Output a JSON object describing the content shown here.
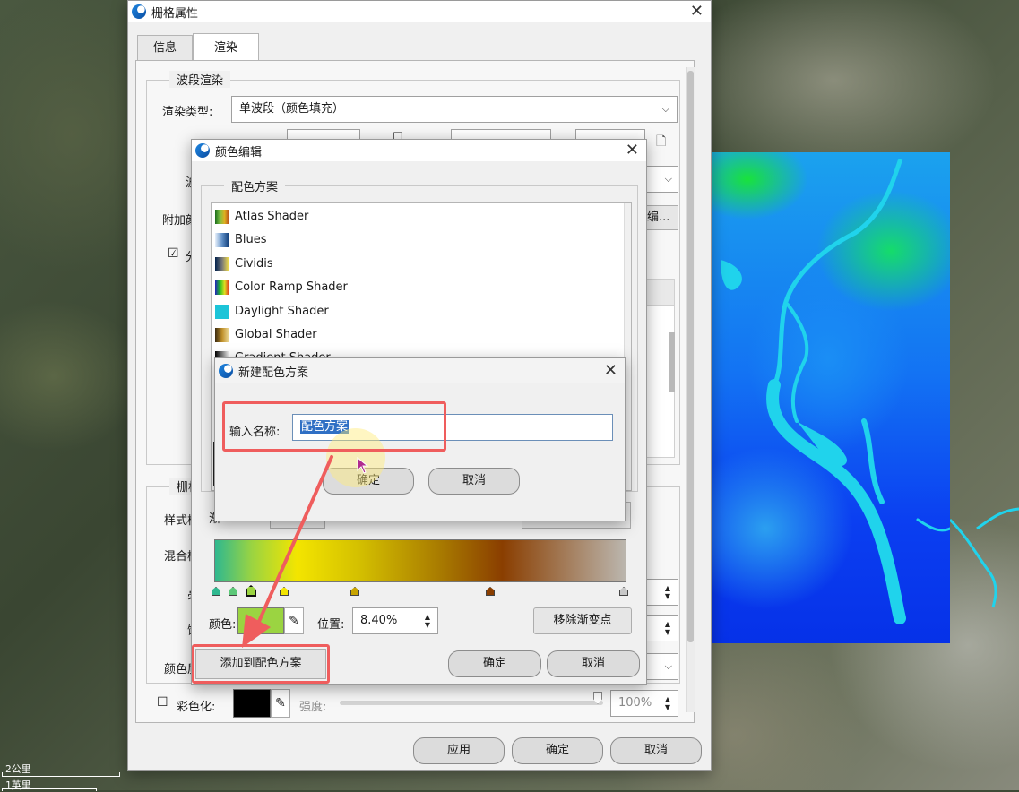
{
  "raster_dialog": {
    "title": "栅格属性",
    "tabs": [
      "信息",
      "渲染"
    ],
    "band_group": "波段渲染",
    "render_type_label": "渲染类型:",
    "render_type_value": "单波段（颜色填充）",
    "band_label_partial": "波",
    "attach_label_partial": "附加颜",
    "attach_btn_partial": "编...",
    "checkbox_partial": "分",
    "raster_group_partial": "栅格",
    "style_label_partial": "样式模",
    "blend_label_partial": "混合模",
    "row3_partial": "亮",
    "row4_partial": "饱",
    "color_label_partial": "颜色质",
    "colorize_label": "彩色化:",
    "strength_label": "强度:",
    "strength_value": "100%",
    "apply_button": "应用",
    "ok_button": "确定",
    "cancel_button": "取消"
  },
  "color_edit": {
    "title": "颜色编辑",
    "scheme_group": "配色方案",
    "schemes": [
      "Atlas Shader",
      "Blues",
      "Cividis",
      "Color Ramp Shader",
      "Daylight Shader",
      "Global Shader",
      "Gradient Shader"
    ],
    "color_label": "颜色:",
    "position_label": "位置:",
    "position_value": "8.40%",
    "remove_stop_button": "移除渐变点",
    "add_scheme_button": "添加到配色方案",
    "ok_button": "确定",
    "cancel_button": "取消",
    "selected_color": "#9bd441"
  },
  "new_scheme": {
    "title": "新建配色方案",
    "name_label": "输入名称:",
    "name_value": "配色方案",
    "ok_button": "确定",
    "cancel_button": "取消"
  },
  "scalebar": {
    "top": "2公里",
    "bottom": "1英里"
  },
  "colors": {
    "highlight": "#ef5d5d",
    "accent": "#0b4ea3"
  }
}
